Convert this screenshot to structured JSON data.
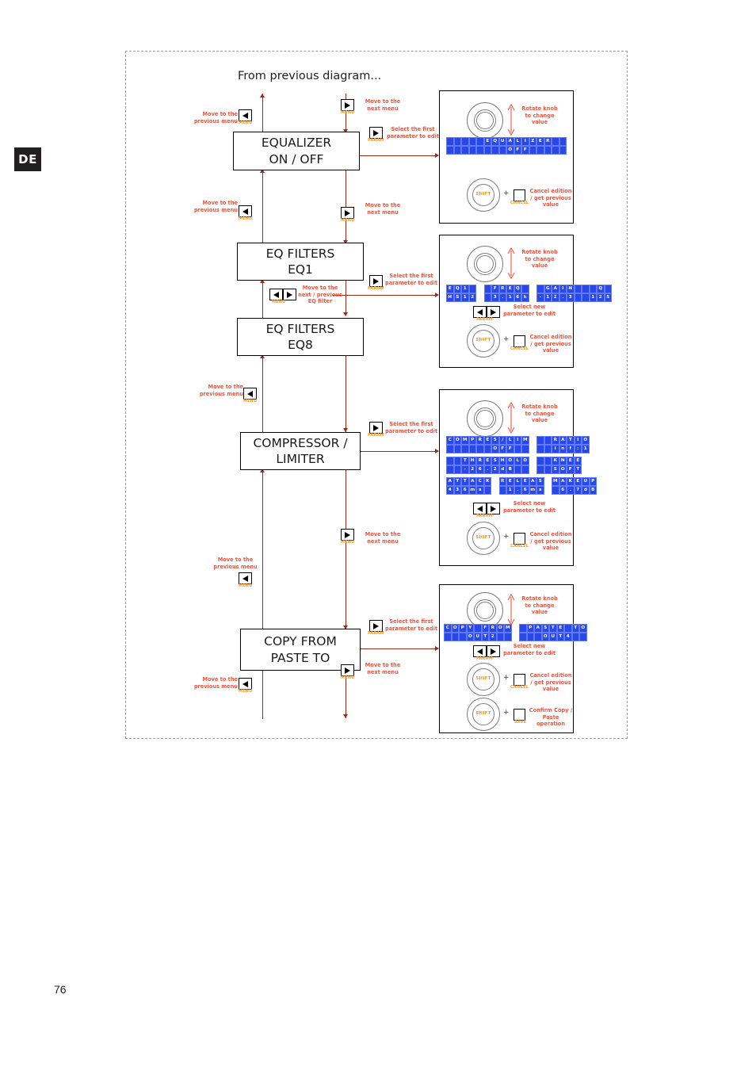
{
  "meta": {
    "language_badge": "DE",
    "page_number": "76"
  },
  "diagram": {
    "title": "From previous diagram...",
    "notes": {
      "prev_menu": "Move to the\nprevious menu",
      "next_menu": "Move to the\nnext menu",
      "select_first_param": "Select the first\nparameter to edit",
      "select_new_param": "Select new\nparameter to edit",
      "next_prev_eq": "Move to the\nnext / previous\nEQ filter",
      "rotate_knob": "Rotate knob\nto change\nvalue",
      "cancel_edition": "Cancel edition\n/ get previous\nvalue",
      "confirm_copy": "Confirm Copy /\nPaste\noperation"
    },
    "button_caps": {
      "menu": "MENU",
      "param": "PARAM",
      "cancel": "CANCEL",
      "save": "SAVE",
      "shift": "SHIFT",
      "plus": "+"
    },
    "nodes": [
      {
        "id": "equalizer",
        "line1": "EQUALIZER",
        "line2": "ON / OFF"
      },
      {
        "id": "eq1",
        "line1": "EQ FILTERS",
        "line2": "EQ1"
      },
      {
        "id": "eq8",
        "line1": "EQ FILTERS",
        "line2": "EQ8"
      },
      {
        "id": "compressor",
        "line1": "COMPRESSOR /",
        "line2": "LIMITER"
      },
      {
        "id": "copypaste",
        "line1": "COPY FROM",
        "line2": "PASTE TO"
      }
    ],
    "panels": [
      {
        "id": "panel-equalizer",
        "lcd_columns": 16,
        "screens": [
          {
            "rows": [
              "     EQUALIZER  ",
              "        OFF     "
            ],
            "seps": []
          }
        ]
      },
      {
        "id": "panel-eqfilters",
        "lcd_columns": 16,
        "screens": [
          {
            "rows": [
              "EQ1   FREQ   GAIN   Q",
              "HS12  3.16k -12.3  125"
            ],
            "seps": [
              4,
              11
            ]
          }
        ]
      },
      {
        "id": "panel-compressor",
        "lcd_columns": 16,
        "screens": [
          {
            "rows": [
              "COMPRES/LIM   RATIO",
              "      OFF     inf:1"
            ],
            "seps": [
              11
            ]
          },
          {
            "rows": [
              "  THRESHOLD   KNEE",
              "  -26.2dB     SOFT"
            ],
            "seps": [
              11
            ]
          },
          {
            "rows": [
              "ATTACK RELEAS MAKEUP",
              "436ms   1.6ms  6.7dB"
            ],
            "seps": [
              6,
              13
            ]
          }
        ]
      },
      {
        "id": "panel-copypaste",
        "lcd_columns": 18,
        "screens": [
          {
            "rows": [
              "COPY FROM  PASTE TO",
              "   OUT2      OUT4  "
            ],
            "seps": [
              9
            ]
          }
        ]
      }
    ]
  },
  "colors": {
    "line": "#9e2b16",
    "note_text": "#f4533c",
    "button_cap": "#f7941e",
    "lcd_background": "#2a48e8",
    "lcd_text": "#ffffff",
    "badge_background": "#231f20"
  }
}
